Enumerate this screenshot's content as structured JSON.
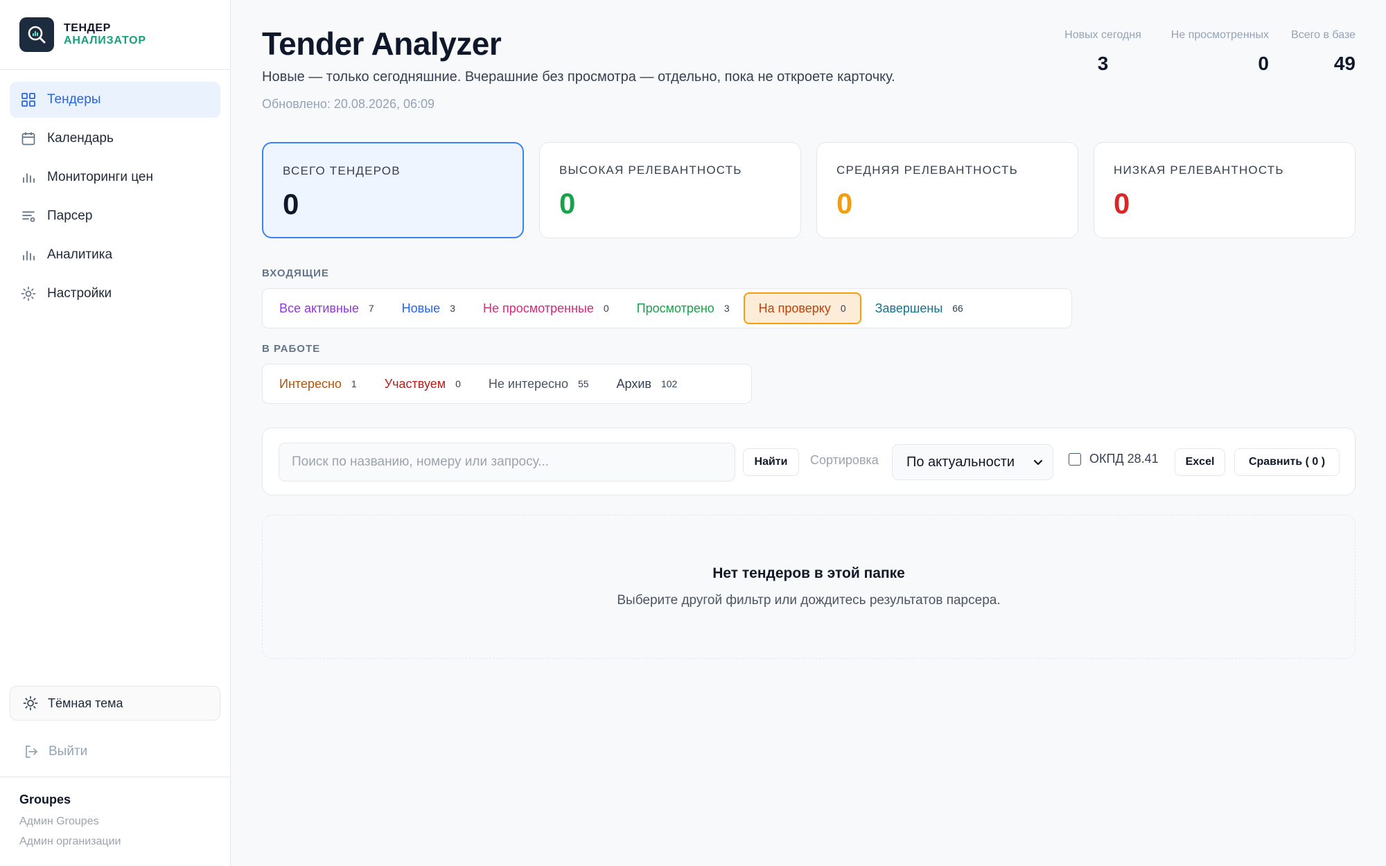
{
  "brand": {
    "line1": "ТЕНДЕР",
    "line2": "АНАЛИЗАТОР"
  },
  "nav": [
    {
      "label": "Тендеры",
      "icon": "grid-icon",
      "active": true
    },
    {
      "label": "Календарь",
      "icon": "calendar-icon"
    },
    {
      "label": "Мониторинги цен",
      "icon": "bar-chart-icon"
    },
    {
      "label": "Парсер",
      "icon": "lines-icon"
    },
    {
      "label": "Аналитика",
      "icon": "bar-chart-icon"
    },
    {
      "label": "Настройки",
      "icon": "gear-icon"
    }
  ],
  "theme_label": "Тёмная тема",
  "logout_label": "Выйти",
  "footer": {
    "org": "Groupes",
    "role1": "Админ Groupes",
    "role2": "Админ организации"
  },
  "header": {
    "title": "Tender Analyzer",
    "subtitle": "Новые — только сегодняшние. Вчерашние без просмотра — отдельно, пока не откроете карточку.",
    "updated": "Обновлено: 20.08.2026, 06:09"
  },
  "top_stats": [
    {
      "label": "Новых сегодня",
      "value": "3"
    },
    {
      "label": "Не просмотренных",
      "value": "0"
    },
    {
      "label": "Всего в базе",
      "value": "49"
    }
  ],
  "cards": [
    {
      "label": "ВСЕГО ТЕНДЕРОВ",
      "value": "0",
      "color": "#0f172a",
      "active": true
    },
    {
      "label": "ВЫСОКАЯ РЕЛЕВАНТНОСТЬ",
      "value": "0",
      "color": "#16a34a"
    },
    {
      "label": "СРЕДНЯЯ РЕЛЕВАНТНОСТЬ",
      "value": "0",
      "color": "#f59e0b"
    },
    {
      "label": "НИЗКАЯ РЕЛЕВАНТНОСТЬ",
      "value": "0",
      "color": "#dc2626"
    }
  ],
  "incoming": {
    "label": "ВХОДЯЩИЕ",
    "tabs": [
      {
        "label": "Все активные",
        "count": "7",
        "color": "#9333ea"
      },
      {
        "label": "Новые",
        "count": "3",
        "color": "#2563eb"
      },
      {
        "label": "Не просмотренные",
        "count": "0",
        "color": "#db2777"
      },
      {
        "label": "Просмотрено",
        "count": "3",
        "color": "#16a34a"
      },
      {
        "label": "На проверку",
        "count": "0",
        "color": "#c2410c",
        "active": true
      },
      {
        "label": "Завершены",
        "count": "66",
        "color": "#0e7490"
      }
    ]
  },
  "in_work": {
    "label": "В РАБОТЕ",
    "tabs": [
      {
        "label": "Интересно",
        "count": "1",
        "color": "#b45309"
      },
      {
        "label": "Участвуем",
        "count": "0",
        "color": "#b91c1c"
      },
      {
        "label": "Не интересно",
        "count": "55",
        "color": "#4b5563"
      },
      {
        "label": "Архив",
        "count": "102",
        "color": "#334155"
      }
    ]
  },
  "toolbar": {
    "search_placeholder": "Поиск по названию, номеру или запросу...",
    "find_label": "Найти",
    "sort_label": "Сортировка",
    "sort_value": "По актуальности",
    "okpd_label": "ОКПД 28.41",
    "excel_label": "Excel",
    "compare_label": "Сравнить ( 0 )"
  },
  "empty": {
    "title": "Нет тендеров в этой папке",
    "subtitle": "Выберите другой фильтр или дождитесь результатов парсера."
  }
}
